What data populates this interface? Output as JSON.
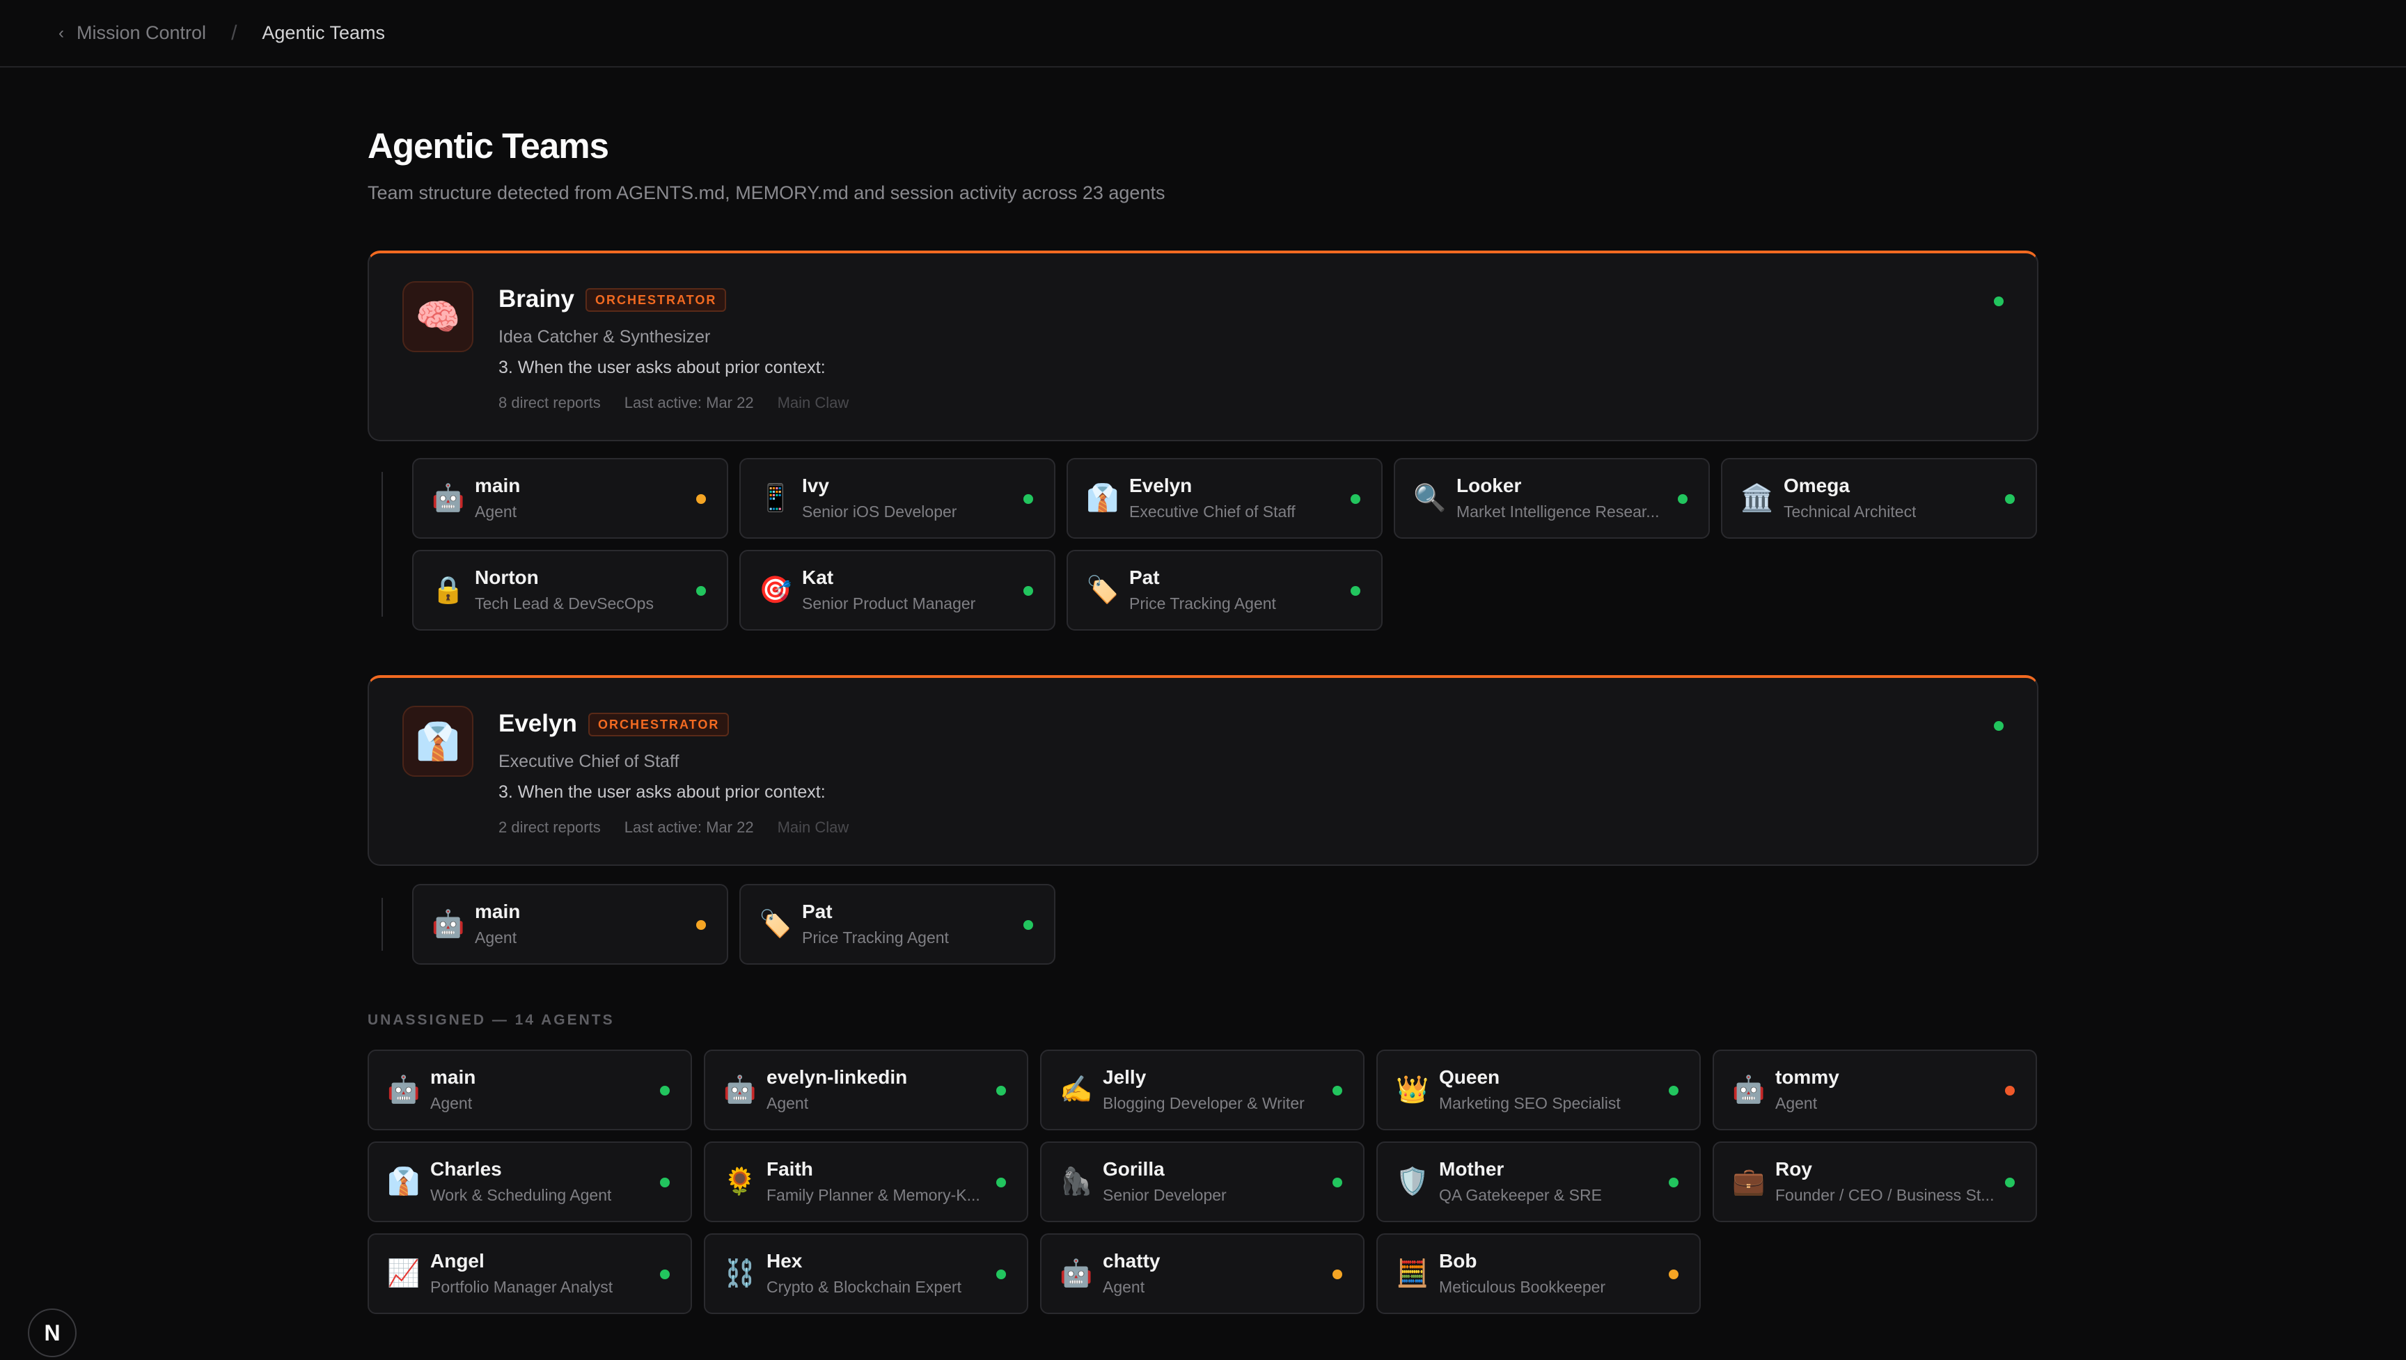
{
  "breadcrumb": {
    "back_label": "Mission Control",
    "separator": "/",
    "current": "Agentic Teams"
  },
  "page": {
    "title": "Agentic Teams",
    "subtitle": "Team structure detected from AGENTS.md, MEMORY.md and session activity across 23 agents"
  },
  "orchestrators": [
    {
      "name": "Brainy",
      "badge": "ORCHESTRATOR",
      "icon": "🧠",
      "icon_name": "brain-icon",
      "role": "Idea Catcher & Synthesizer",
      "description": "3. When the user asks about prior context:",
      "direct_reports": "8 direct reports",
      "last_active": "Last active: Mar 22",
      "claw": "Main Claw",
      "status": "green",
      "reports": [
        {
          "name": "main",
          "role": "Agent",
          "icon": "🤖",
          "icon_name": "robot-icon",
          "status": "amber"
        },
        {
          "name": "Ivy",
          "role": "Senior iOS Developer",
          "icon": "📱",
          "icon_name": "phone-icon",
          "status": "green"
        },
        {
          "name": "Evelyn",
          "role": "Executive Chief of Staff",
          "icon": "👔",
          "icon_name": "shirt-tie-icon",
          "status": "green"
        },
        {
          "name": "Looker",
          "role": "Market Intelligence Resear...",
          "icon": "🔍",
          "icon_name": "magnifier-icon",
          "status": "green"
        },
        {
          "name": "Omega",
          "role": "Technical Architect",
          "icon": "🏛️",
          "icon_name": "classical-building-icon",
          "status": "green"
        },
        {
          "name": "Norton",
          "role": "Tech Lead & DevSecOps",
          "icon": "🔒",
          "icon_name": "lock-icon",
          "status": "green"
        },
        {
          "name": "Kat",
          "role": "Senior Product Manager",
          "icon": "🎯",
          "icon_name": "target-icon",
          "status": "green"
        },
        {
          "name": "Pat",
          "role": "Price Tracking Agent",
          "icon": "🏷️",
          "icon_name": "price-tag-icon",
          "status": "green"
        }
      ]
    },
    {
      "name": "Evelyn",
      "badge": "ORCHESTRATOR",
      "icon": "👔",
      "icon_name": "shirt-tie-icon",
      "role": "Executive Chief of Staff",
      "description": "3. When the user asks about prior context:",
      "direct_reports": "2 direct reports",
      "last_active": "Last active: Mar 22",
      "claw": "Main Claw",
      "status": "green",
      "reports": [
        {
          "name": "main",
          "role": "Agent",
          "icon": "🤖",
          "icon_name": "robot-icon",
          "status": "amber"
        },
        {
          "name": "Pat",
          "role": "Price Tracking Agent",
          "icon": "🏷️",
          "icon_name": "price-tag-icon",
          "status": "green"
        }
      ]
    }
  ],
  "unassigned": {
    "label": "UNASSIGNED — 14 AGENTS",
    "agents": [
      {
        "name": "main",
        "role": "Agent",
        "icon": "🤖",
        "icon_name": "robot-icon",
        "status": "green"
      },
      {
        "name": "evelyn-linkedin",
        "role": "Agent",
        "icon": "🤖",
        "icon_name": "robot-icon",
        "status": "green"
      },
      {
        "name": "Jelly",
        "role": "Blogging Developer & Writer",
        "icon": "✍️",
        "icon_name": "writing-hand-icon",
        "status": "green"
      },
      {
        "name": "Queen",
        "role": "Marketing SEO Specialist",
        "icon": "👑",
        "icon_name": "crown-icon",
        "status": "green"
      },
      {
        "name": "tommy",
        "role": "Agent",
        "icon": "🤖",
        "icon_name": "robot-icon",
        "status": "red"
      },
      {
        "name": "Charles",
        "role": "Work & Scheduling Agent",
        "icon": "👔",
        "icon_name": "shirt-tie-icon",
        "status": "green"
      },
      {
        "name": "Faith",
        "role": "Family Planner & Memory-K...",
        "icon": "🌻",
        "icon_name": "sunflower-icon",
        "status": "green"
      },
      {
        "name": "Gorilla",
        "role": "Senior Developer",
        "icon": "🦍",
        "icon_name": "gorilla-icon",
        "status": "green"
      },
      {
        "name": "Mother",
        "role": "QA Gatekeeper & SRE",
        "icon": "🛡️",
        "icon_name": "shield-icon",
        "status": "green"
      },
      {
        "name": "Roy",
        "role": "Founder / CEO / Business St...",
        "icon": "💼",
        "icon_name": "briefcase-icon",
        "status": "green"
      },
      {
        "name": "Angel",
        "role": "Portfolio Manager Analyst",
        "icon": "📈",
        "icon_name": "chart-up-icon",
        "status": "green"
      },
      {
        "name": "Hex",
        "role": "Crypto & Blockchain Expert",
        "icon": "⛓️",
        "icon_name": "chain-icon",
        "status": "green"
      },
      {
        "name": "chatty",
        "role": "Agent",
        "icon": "🤖",
        "icon_name": "robot-icon",
        "status": "amber"
      },
      {
        "name": "Bob",
        "role": "Meticulous Bookkeeper",
        "icon": "🧮",
        "icon_name": "abacus-icon",
        "status": "amber"
      }
    ]
  },
  "corner_badge": "N"
}
